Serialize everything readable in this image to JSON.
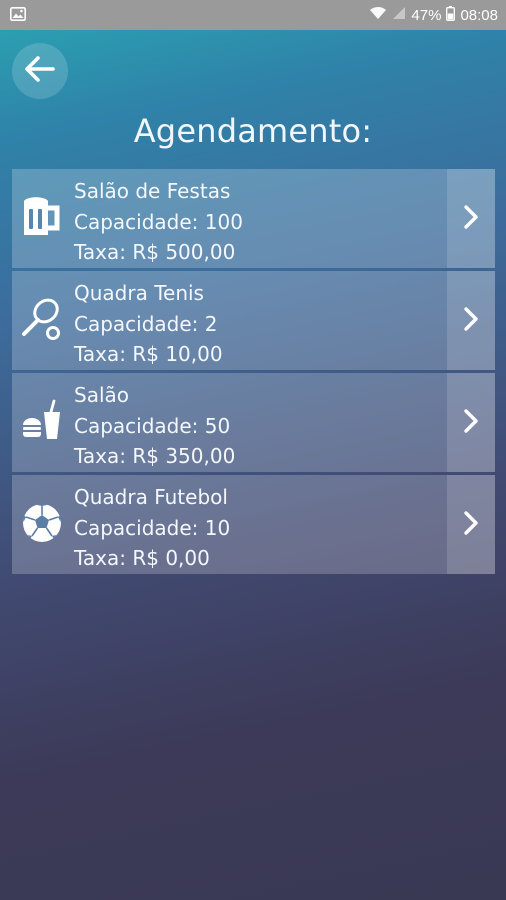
{
  "status_bar": {
    "battery_percent": "47%",
    "time": "08:08",
    "icons": [
      "gallery-notification-icon",
      "wifi-icon",
      "signal-icon",
      "battery-icon"
    ]
  },
  "header": {
    "title": "Agendamento:",
    "back_icon": "arrow-left-icon"
  },
  "venues": [
    {
      "name": "Salão de Festas",
      "capacity": "Capacidade: 100",
      "fee": "Taxa: R$ 500,00",
      "icon": "beer-mug-icon"
    },
    {
      "name": "Quadra Tenis",
      "capacity": "Capacidade: 2",
      "fee": "Taxa: R$ 10,00",
      "icon": "tennis-racket-icon"
    },
    {
      "name": "Salão",
      "capacity": "Capacidade: 50",
      "fee": "Taxa: R$ 350,00",
      "icon": "fast-food-icon"
    },
    {
      "name": "Quadra Futebol",
      "capacity": "Capacidade: 10",
      "fee": "Taxa: R$ 0,00",
      "icon": "soccer-ball-icon"
    }
  ],
  "colors": {
    "background_top": "#2aa7b3",
    "background_bottom": "#3a3954",
    "status_bar": "#9a9a9a"
  }
}
